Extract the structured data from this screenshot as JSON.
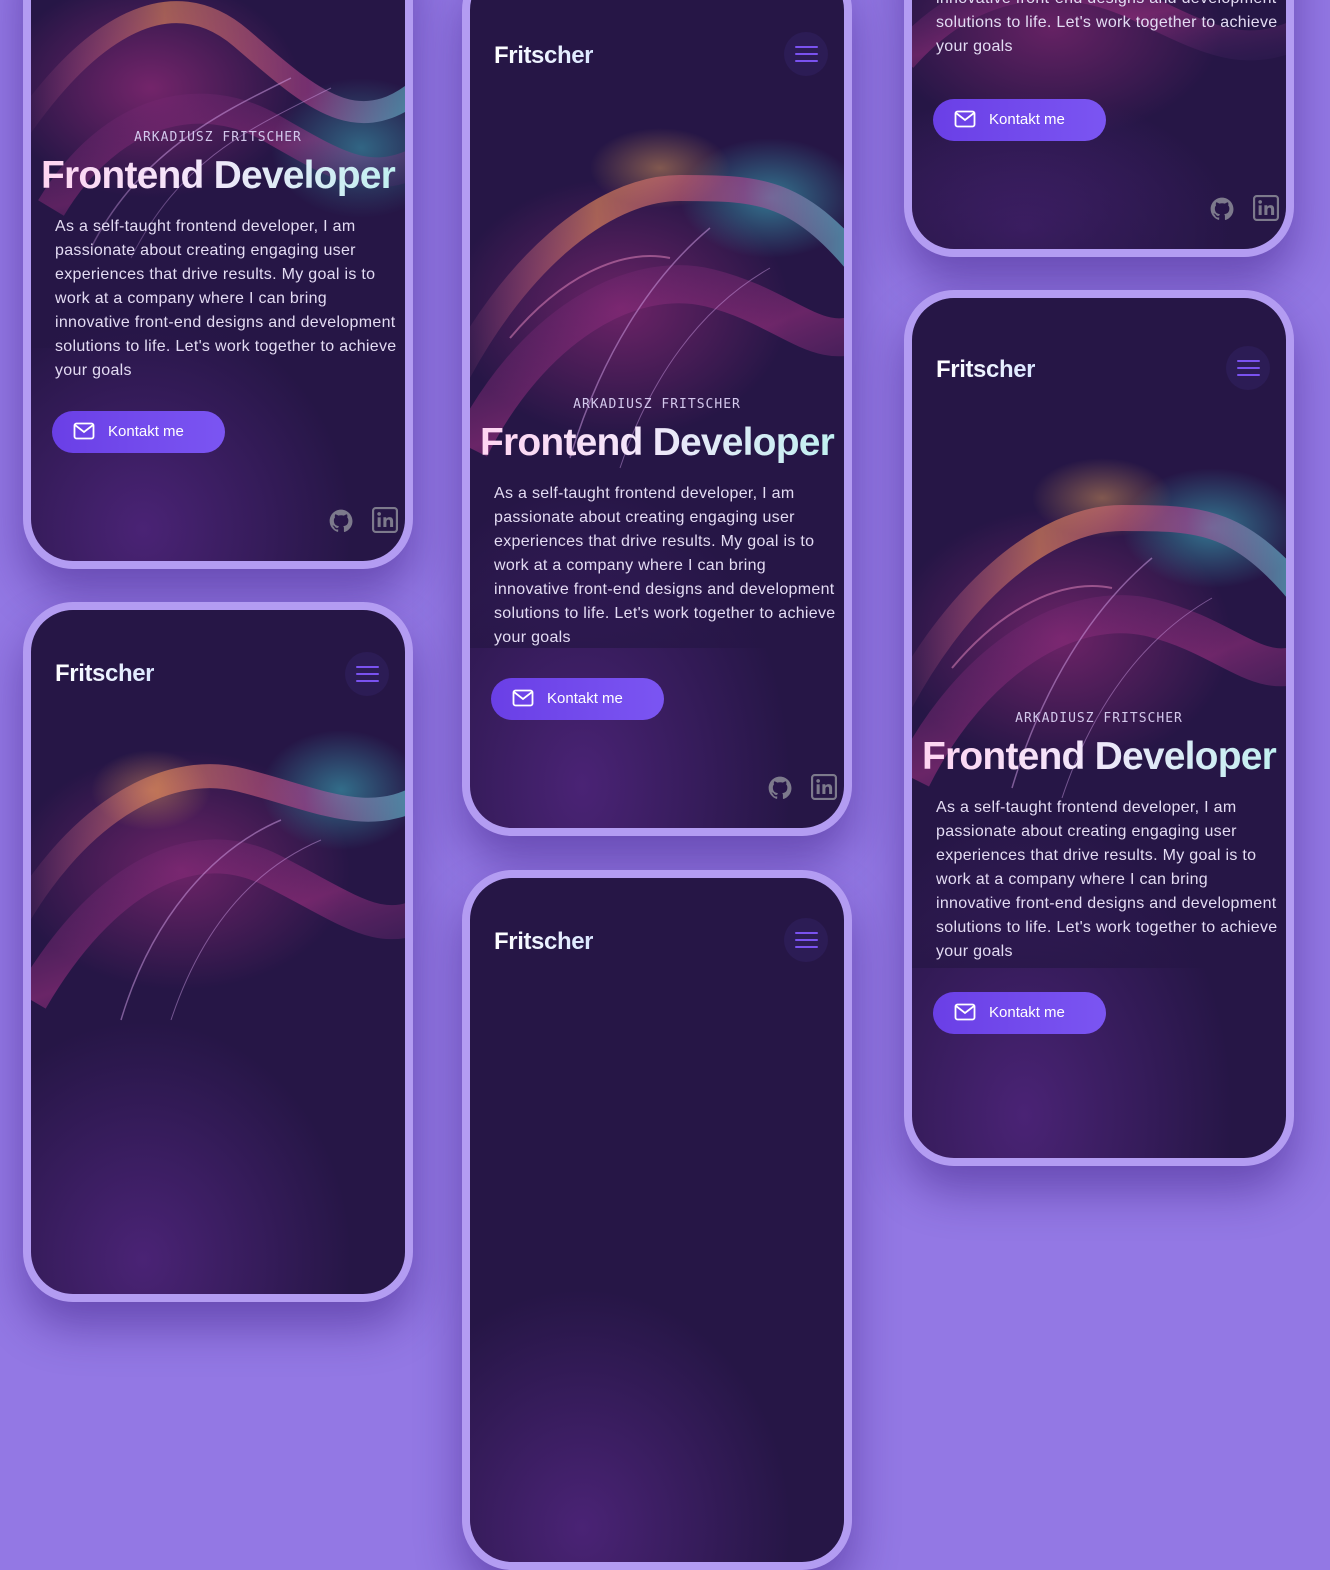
{
  "brand": {
    "logo": "Fritscher"
  },
  "hero": {
    "eyebrow": "ARKADIUSZ FRITSCHER",
    "headline": "Frontend Developer",
    "intro": "As a self-taught frontend developer, I am passionate about creating engaging user experiences that drive results. My goal is to work at a company where I can bring innovative front-end designs and development solutions to life. Let's work together to achieve your goals",
    "intro_tail": "innovative front-end designs and development solutions to life. Let's work together to achieve your goals",
    "cta_label": "Kontakt me",
    "cta_icon": "mail-icon"
  },
  "nav": {
    "menu_icon": "hamburger-menu-icon"
  },
  "social": [
    {
      "name": "github",
      "icon": "github-icon"
    },
    {
      "name": "linkedin",
      "icon": "linkedin-icon"
    }
  ],
  "colors": {
    "page_background": "#9378e4",
    "phone_frame": "#b39cf2",
    "screen_background": "#261646",
    "accent": "#6a3fe6",
    "icon_gray": "#7d7a8c"
  }
}
